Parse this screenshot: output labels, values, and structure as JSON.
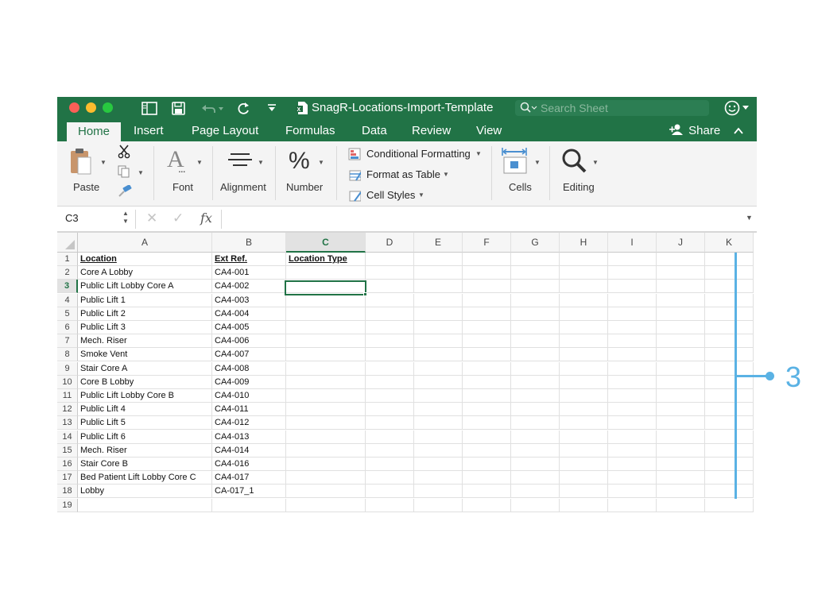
{
  "window": {
    "title": "SnagR-Locations-Import-Template",
    "search_placeholder": "Search Sheet"
  },
  "tabs": [
    {
      "label": "Home",
      "active": true
    },
    {
      "label": "Insert"
    },
    {
      "label": "Page Layout"
    },
    {
      "label": "Formulas"
    },
    {
      "label": "Data"
    },
    {
      "label": "Review"
    },
    {
      "label": "View"
    }
  ],
  "share_label": "Share",
  "ribbon": {
    "paste": "Paste",
    "font": "Font",
    "alignment": "Alignment",
    "number": "Number",
    "conditional_formatting": "Conditional Formatting",
    "format_as_table": "Format as Table",
    "cell_styles": "Cell Styles",
    "cells": "Cells",
    "editing": "Editing"
  },
  "formula_bar": {
    "name_box": "C3",
    "fx": "fx",
    "content": ""
  },
  "columns": [
    "A",
    "B",
    "C",
    "D",
    "E",
    "F",
    "G",
    "H",
    "I",
    "J",
    "K"
  ],
  "selected_column": "C",
  "selected_row": 3,
  "rows": [
    {
      "n": "1",
      "a": "Location",
      "b": "Ext Ref.",
      "c": "Location Type"
    },
    {
      "n": "2",
      "a": "Core A Lobby",
      "b": "CA4-001",
      "c": ""
    },
    {
      "n": "3",
      "a": "Public Lift Lobby Core A",
      "b": "CA4-002",
      "c": ""
    },
    {
      "n": "4",
      "a": "Public Lift 1",
      "b": "CA4-003",
      "c": ""
    },
    {
      "n": "5",
      "a": "Public Lift 2",
      "b": "CA4-004",
      "c": ""
    },
    {
      "n": "6",
      "a": "Public Lift 3",
      "b": "CA4-005",
      "c": ""
    },
    {
      "n": "7",
      "a": "Mech. Riser",
      "b": "CA4-006",
      "c": ""
    },
    {
      "n": "8",
      "a": "Smoke Vent",
      "b": "CA4-007",
      "c": ""
    },
    {
      "n": "9",
      "a": "Stair Core A",
      "b": "CA4-008",
      "c": ""
    },
    {
      "n": "10",
      "a": "Core B Lobby",
      "b": "CA4-009",
      "c": ""
    },
    {
      "n": "11",
      "a": "Public Lift Lobby Core B",
      "b": "CA4-010",
      "c": ""
    },
    {
      "n": "12",
      "a": "Public Lift 4",
      "b": "CA4-011",
      "c": ""
    },
    {
      "n": "13",
      "a": "Public Lift 5",
      "b": "CA4-012",
      "c": ""
    },
    {
      "n": "14",
      "a": "Public Lift 6",
      "b": "CA4-013",
      "c": ""
    },
    {
      "n": "15",
      "a": "Mech. Riser",
      "b": "CA4-014",
      "c": ""
    },
    {
      "n": "16",
      "a": "Stair Core B",
      "b": "CA4-016",
      "c": ""
    },
    {
      "n": "17",
      "a": "Bed Patient Lift Lobby Core C",
      "b": "CA4-017",
      "c": ""
    },
    {
      "n": "18",
      "a": "Lobby",
      "b": "CA-017_1",
      "c": ""
    },
    {
      "n": "19",
      "a": "",
      "b": "",
      "c": ""
    }
  ],
  "annotation": {
    "label": "3",
    "color": "#5ab2e4"
  },
  "colors": {
    "excel_green": "#217346",
    "ribbon_bg": "#f4f4f4"
  }
}
